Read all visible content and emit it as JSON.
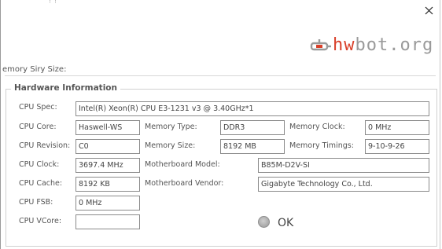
{
  "window": {
    "close_icon": "close-icon",
    "logo": {
      "hw": "hw",
      "rest": "bot.org",
      "mark_icon": "hwbot-bolt-icon"
    },
    "colors": {
      "logo_accent": "#d9402a",
      "logo_gray": "#9a9a9a"
    }
  },
  "memory": {
    "truncated_label": "emory Siry Size:"
  },
  "hardware": {
    "legend": "Hardware Information",
    "cpu_spec_label": "CPU Spec:",
    "cpu_spec": "Intel(R) Xeon(R) CPU E3-1231 v3 @ 3.40GHz*1",
    "cpu_core_label": "CPU Core:",
    "cpu_core": "Haswell-WS",
    "memory_type_label": "Memory Type:",
    "memory_type": "DDR3",
    "memory_clock_label": "Memory Clock:",
    "memory_clock": "0 MHz",
    "cpu_revision_label": "CPU Revision:",
    "cpu_revision": "C0",
    "memory_size_label": "Memory Size:",
    "memory_size": "8192 MB",
    "memory_timings_label": "Memory Timings:",
    "memory_timings": "9-10-9-26",
    "cpu_clock_label": "CPU Clock:",
    "cpu_clock": "3697.4 MHz",
    "mb_model_label": "Motherboard Model:",
    "mb_model": "B85M-D2V-SI",
    "cpu_cache_label": "CPU Cache:",
    "cpu_cache": "8192 KB",
    "mb_vendor_label": "Motherboard Vendor:",
    "mb_vendor": "Gigabyte Technology Co., Ltd.",
    "cpu_fsb_label": "CPU FSB:",
    "cpu_fsb": "0 MHz",
    "cpu_vcore_label": "CPU VCore:",
    "cpu_vcore": ""
  },
  "ok": {
    "label": "OK"
  }
}
